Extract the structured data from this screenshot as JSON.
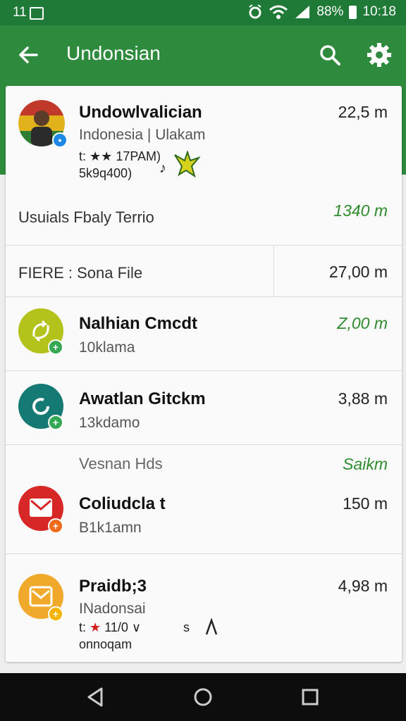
{
  "status": {
    "time": "11",
    "battery": "88%",
    "clock": "10:18"
  },
  "appbar": {
    "title": "Undonsian"
  },
  "profile": {
    "name": "Undowlvalician",
    "subtitle": "Indonesia | Ulakam",
    "meta1_prefix": "t:",
    "meta1_stars": "★★",
    "meta1_rest": "17PAM)",
    "meta2": "5k9q400)",
    "amount": "22,5 m"
  },
  "usage": {
    "label": "Usuials Fbaly Terrio",
    "amount": "1340 m"
  },
  "file": {
    "label": "FIERE : Sona File",
    "amount": "27,00 m"
  },
  "items": [
    {
      "name": "Nalhian Cmcdt",
      "sub": "10klama",
      "amount": "Z,00 m",
      "color": "#b4c21c",
      "badge": "+",
      "badge_color": "#34a853"
    },
    {
      "name": "Awatlan Gitckm",
      "sub": "13kdamo",
      "amount": "3,88 m",
      "color": "#157a73",
      "badge": "+",
      "badge_color": "#34a853"
    }
  ],
  "vesnan": {
    "label": "Vesnan Hds",
    "amount": "Saikm"
  },
  "items2": [
    {
      "name": "Coliudcla t",
      "sub": "B1k1amn",
      "amount": "150 m",
      "color": "#d82727",
      "badge": "+",
      "badge_color": "#f06a1a"
    }
  ],
  "last": {
    "name": "Praidb;3",
    "sub": "INadonsai",
    "meta_prefix": "t:",
    "meta_star": "★",
    "meta_rest": "11/0 ∨",
    "meta_tail": "s",
    "meta_line2": "onnoqam",
    "amount": "4,98 m",
    "color": "#f0a92a",
    "badge": "+",
    "badge_color": "#f5b400"
  }
}
